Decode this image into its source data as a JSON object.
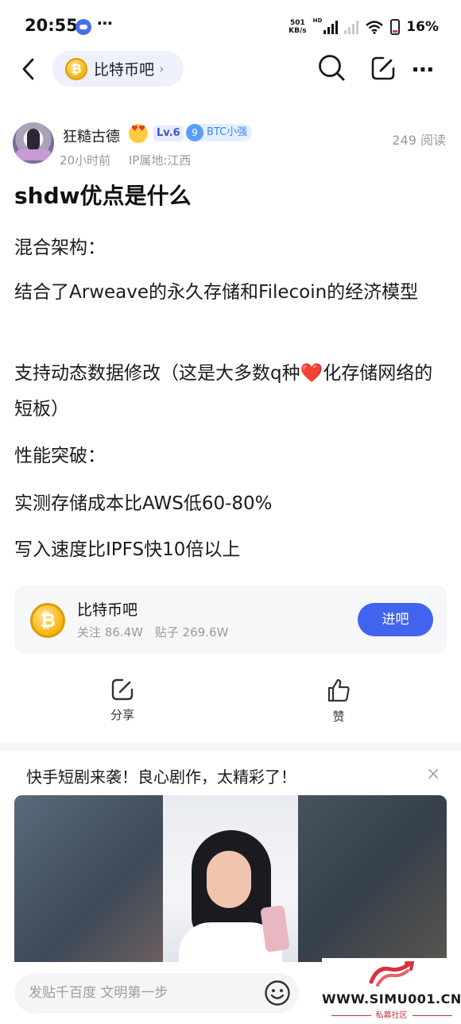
{
  "status_bar": {
    "time": "20:55",
    "more": "⋯",
    "speed_value": "501",
    "speed_unit": "KB/s",
    "hd": "HD",
    "battery": "16%"
  },
  "nav": {
    "forum_name": "比特币吧",
    "forum_icon_glyph": "₿",
    "chevron": "›",
    "more": "⋯",
    "icons": [
      "back-icon",
      "search-icon",
      "edit-icon",
      "more-icon"
    ]
  },
  "author": {
    "name": "狂糙古德",
    "level": "Lv.6",
    "badge_number": "9",
    "badge_label": "BTC小强",
    "time_ago": "20小时前",
    "ip_location": "IP属地:江西",
    "reads": "249 阅读"
  },
  "post": {
    "title": "shdw优点是什么",
    "paragraphs": [
      "混合架构：",
      "结合了Arweave的永久存储和Filecoin的经济模型",
      "支持动态数据修改（这是大多数q种❤️化存储网络的短板）",
      "性能突破：",
      "实测存储成本比AWS低60-80%",
      "写入速度比IPFS快10倍以上"
    ]
  },
  "forum_card": {
    "name": "比特币吧",
    "coin_glyph": "₿",
    "followers": "关注 86.4W",
    "posts": "贴子 269.6W",
    "join_label": "进吧"
  },
  "actions": {
    "share_label": "分享",
    "like_label": "赞"
  },
  "ad": {
    "title": "快手短剧来袭！良心剧作，太精彩了！",
    "close": "×"
  },
  "reply": {
    "placeholder": "发贴千百度 文明第一步"
  },
  "watermark": {
    "url": "WWW.SIMU001.CN",
    "subtitle": "私募社区"
  },
  "colors": {
    "accent": "#4164ef",
    "level_bg": "#e7ecff",
    "badge_bg": "#e4f0ff",
    "muted_text": "#9a9a9a"
  }
}
